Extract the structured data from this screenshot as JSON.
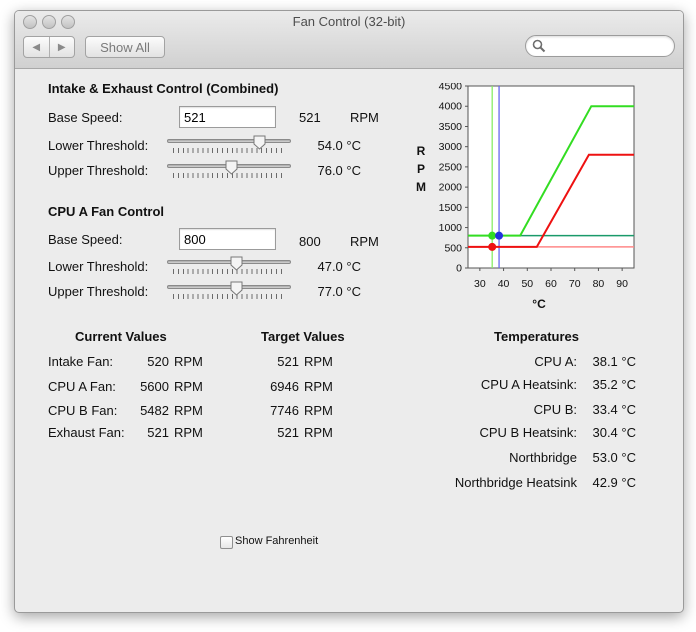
{
  "window": {
    "title": "Fan Control (32-bit)"
  },
  "toolbar": {
    "back_label": "◀",
    "forward_label": "▶",
    "show_all_label": "Show All",
    "search_placeholder": "",
    "search_value": ""
  },
  "combined": {
    "title": "Intake & Exhaust Control (Combined)",
    "base_speed_label": "Base Speed:",
    "base_speed_value": "521",
    "base_speed_display": "521",
    "base_speed_unit": "RPM",
    "lower_label": "Lower Threshold:",
    "lower_value": "54.0 °C",
    "lower_level": 0.77,
    "upper_label": "Upper Threshold:",
    "upper_value": "76.0 °C",
    "upper_level": 0.52
  },
  "cpu_a": {
    "title": "CPU A Fan Control",
    "base_speed_label": "Base Speed:",
    "base_speed_value": "800",
    "base_speed_display": "800",
    "base_speed_unit": "RPM",
    "lower_label": "Lower Threshold:",
    "lower_value": "47.0 °C",
    "lower_level": 0.56,
    "upper_label": "Upper Threshold:",
    "upper_value": "77.0 °C",
    "upper_level": 0.56
  },
  "current": {
    "header": "Current Values",
    "rows": [
      {
        "label": "Intake Fan:",
        "value": "520",
        "unit": "RPM"
      },
      {
        "label": "CPU A Fan:",
        "value": "5600",
        "unit": "RPM"
      },
      {
        "label": "CPU B Fan:",
        "value": "5482",
        "unit": "RPM"
      },
      {
        "label": "Exhaust Fan:",
        "value": "521",
        "unit": "RPM"
      }
    ]
  },
  "target": {
    "header": "Target Values",
    "rows": [
      {
        "value": "521",
        "unit": "RPM"
      },
      {
        "value": "6946",
        "unit": "RPM"
      },
      {
        "value": "7746",
        "unit": "RPM"
      },
      {
        "value": "521",
        "unit": "RPM"
      }
    ]
  },
  "temperatures": {
    "header": "Temperatures",
    "rows": [
      {
        "label": "CPU A:",
        "value": "38.1 °C"
      },
      {
        "label": "CPU A Heatsink:",
        "value": "35.2 °C"
      },
      {
        "label": "CPU B:",
        "value": "33.4 °C"
      },
      {
        "label": "CPU B Heatsink:",
        "value": "30.4 °C"
      },
      {
        "label": "Northbridge",
        "value": "53.0 °C"
      },
      {
        "label": "Northbridge Heatsink",
        "value": "42.9 °C"
      }
    ]
  },
  "fahrenheit": {
    "label": "Show Fahrenheit",
    "checked": false
  },
  "colors": {
    "green": "#33dd22",
    "red": "#ee1111",
    "blue": "#2233dd",
    "green_dark": "#1a9a2a"
  },
  "chart_data": {
    "type": "line",
    "xlabel": "°C",
    "ylabel": "RPM",
    "ylabel_letters": [
      "R",
      "P",
      "M"
    ],
    "xlim": [
      25,
      95
    ],
    "ylim": [
      0,
      4500
    ],
    "x_ticks": [
      "30",
      "40",
      "50",
      "60",
      "70",
      "80",
      "90"
    ],
    "y_ticks": [
      "0",
      "500",
      "1000",
      "1500",
      "2000",
      "2500",
      "3000",
      "3500",
      "4000",
      "4500"
    ],
    "series": [
      {
        "color": "#33dd22",
        "points": [
          [
            25,
            800
          ],
          [
            47,
            800
          ],
          [
            77,
            4000
          ],
          [
            95,
            4000
          ]
        ]
      },
      {
        "color": "#ee1111",
        "points": [
          [
            25,
            521
          ],
          [
            54,
            521
          ],
          [
            76,
            2800
          ],
          [
            95,
            2800
          ]
        ]
      }
    ],
    "reference_lines": [
      {
        "axis": "y",
        "value": 800,
        "color": "#1a9a6a"
      },
      {
        "axis": "y",
        "value": 521,
        "color": "#ff8888"
      },
      {
        "axis": "x",
        "value": 35.2,
        "color": "#88ee66"
      },
      {
        "axis": "x",
        "value": 38.1,
        "color": "#6666ee"
      }
    ],
    "markers": [
      {
        "x": 35.2,
        "y": 800,
        "color": "#33dd22"
      },
      {
        "x": 38.1,
        "y": 800,
        "color": "#2233dd"
      },
      {
        "x": 35.2,
        "y": 521,
        "color": "#ee1111"
      }
    ]
  }
}
